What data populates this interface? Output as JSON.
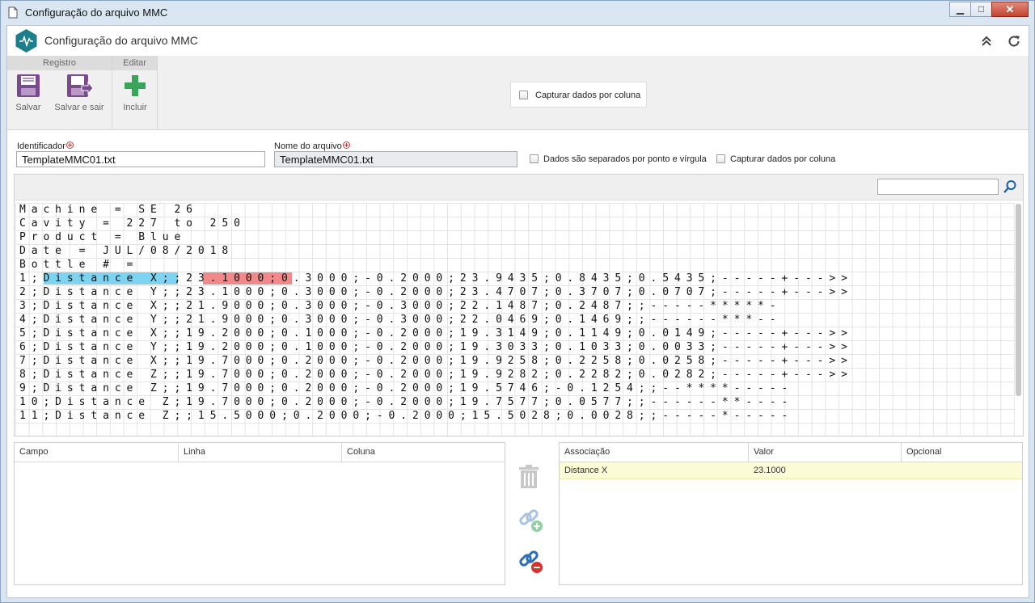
{
  "window": {
    "title": "Configuração do arquivo MMC",
    "minimize": "▁",
    "maximize": "□",
    "close": "✕"
  },
  "app": {
    "title": "Configuração do arquivo MMC"
  },
  "ribbon": {
    "groups": [
      {
        "title": "Registro",
        "buttons": [
          {
            "label": "Salvar"
          },
          {
            "label": "Salvar e sair"
          }
        ]
      },
      {
        "title": "Editar",
        "buttons": [
          {
            "label": "Incluir"
          }
        ]
      }
    ],
    "capture_checkbox": "Capturar dados por coluna"
  },
  "form": {
    "identifier_label": "Identificador",
    "identifier_value": "TemplateMMC01.txt",
    "filename_label": "Nome do arquivo",
    "filename_value": "TemplateMMC01.txt",
    "semicolon_label": "Dados são separados por ponto e vírgula",
    "capture_label": "Capturar dados por coluna"
  },
  "file_lines": [
    "Machine = SE 26",
    "Cavity = 227 to 250",
    "Product = Blue",
    "Date = JUL/08/2018",
    "Bottle # =",
    "1;Distance X;;23.1000;0.3000;-0.2000;23.9435;0.8435;0.5435;-----+--->>",
    "2;Distance Y;;23.1000;0.3000;-0.2000;23.4707;0.3707;0.0707;-----+--->>",
    "3;Distance X;;21.9000;0.3000;-0.3000;22.1487;0.2487;;-----*****-",
    "4;Distance Y;;21.9000;0.3000;-0.3000;22.0469;0.1469;;------***--",
    "5;Distance X;;19.2000;0.1000;-0.2000;19.3149;0.1149;0.0149;-----+--->>",
    "6;Distance Y;;19.2000;0.1000;-0.2000;19.3033;0.1033;0.0033;-----+--->>",
    "7;Distance X;;19.7000;0.2000;-0.2000;19.9258;0.2258;0.0258;-----+--->>",
    "8;Distance Z;;19.7000;0.2000;-0.2000;19.9282;0.2282;0.0282;-----+--->>",
    "9;Distance Z;;19.7000;0.2000;-0.2000;19.5746;-0.1254;;--****-----",
    "10;Distance Z;19.7000;0.2000;-0.2000;19.7577;0.0577;;------**----",
    "11;Distance Z;;15.5000;0.2000;-0.2000;15.5028;0.0028;;-----*-----"
  ],
  "fields_table": {
    "columns": [
      "Campo",
      "Linha",
      "Coluna"
    ]
  },
  "assoc_table": {
    "columns": [
      "Associação",
      "Valor",
      "Opcional"
    ],
    "rows": [
      {
        "assoc": "Distance X",
        "value": "23.1000",
        "optional": ""
      }
    ]
  },
  "colors": {
    "accent": "#1d7f8c",
    "highlight_blue": "#7dd3f0",
    "highlight_red": "#f08a8a",
    "row_selected": "#fdfbd6"
  }
}
